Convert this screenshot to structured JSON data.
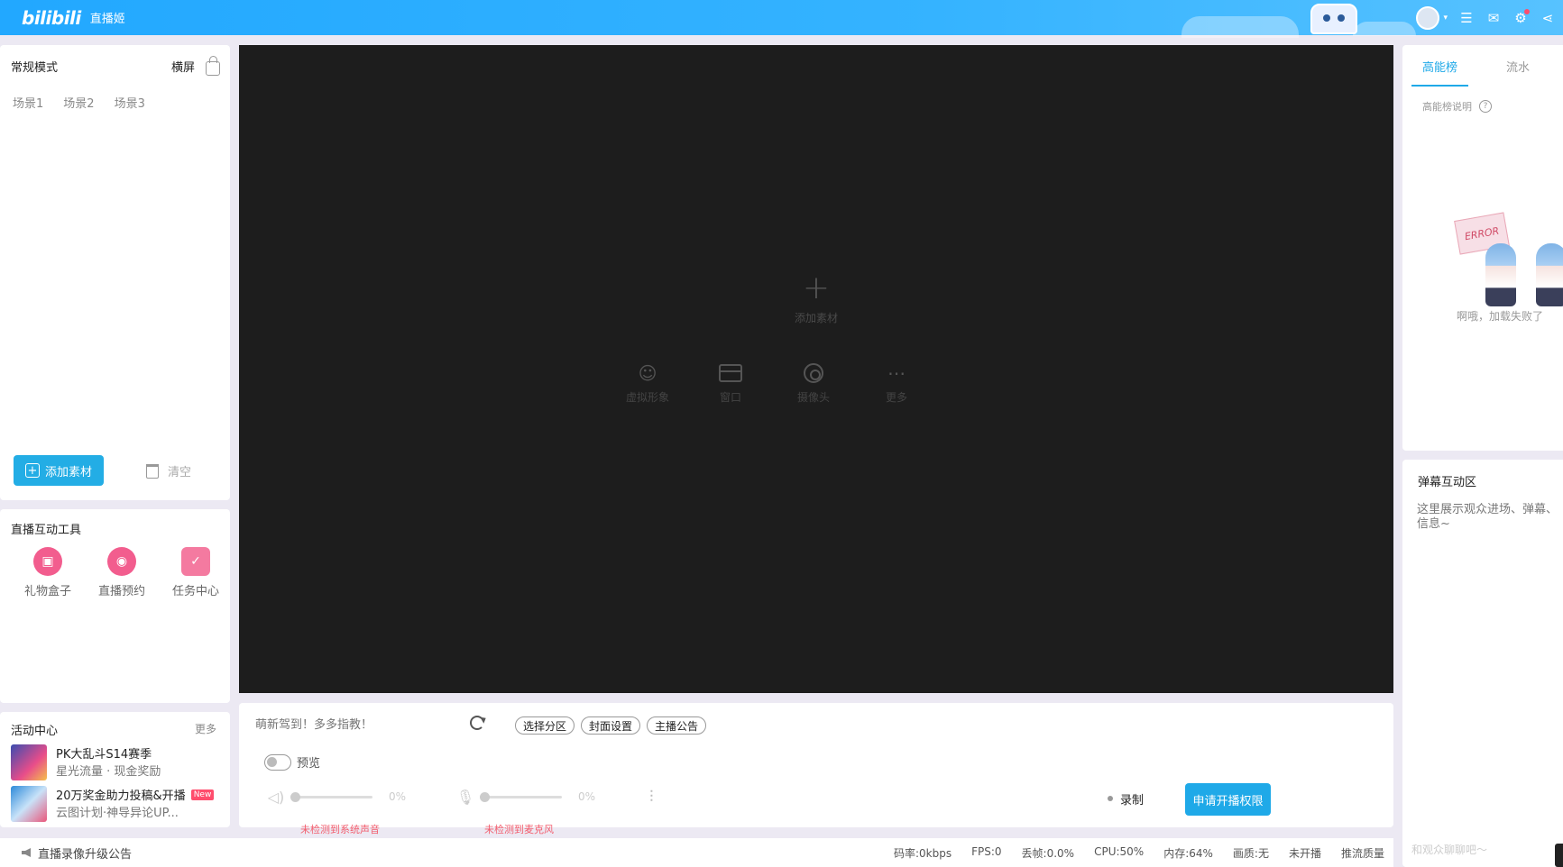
{
  "topbar": {
    "logo": "bilibili",
    "app_name": "直播姬",
    "icons": [
      "avatar",
      "menu-icon",
      "mail-icon",
      "settings-icon",
      "share-icon"
    ]
  },
  "scene_panel": {
    "mode": "常规模式",
    "orientation": "横屏",
    "scenes": [
      "场景1",
      "场景2",
      "场景3"
    ],
    "add_button": "添加素材",
    "clear_button": "清空"
  },
  "tools_panel": {
    "title": "直播互动工具",
    "tools": [
      {
        "label": "礼物盒子",
        "icon": "gift-box-icon"
      },
      {
        "label": "直播预约",
        "icon": "live-reservation-icon"
      },
      {
        "label": "任务中心",
        "icon": "task-center-icon"
      }
    ]
  },
  "activity_panel": {
    "title": "活动中心",
    "more": "更多",
    "items": [
      {
        "name": "PK大乱斗S14赛季",
        "sub": "星光流量 · 现金奖励",
        "badge": ""
      },
      {
        "name": "20万奖金助力投稿&开播",
        "sub": "云图计划·神导异论UP...",
        "badge": "New"
      }
    ]
  },
  "preview": {
    "add_source_label": "添加素材",
    "sources": [
      {
        "label": "虚拟形象",
        "icon": "avatar-figure-icon"
      },
      {
        "label": "窗口",
        "icon": "window-icon"
      },
      {
        "label": "摄像头",
        "icon": "camera-icon"
      },
      {
        "label": "更多",
        "icon": "more-icon"
      }
    ]
  },
  "control_panel": {
    "title_placeholder": "萌新驾到！多多指教！",
    "pills": [
      "选择分区",
      "封面设置",
      "主播公告"
    ],
    "preview_toggle": "预览",
    "system_audio": {
      "percent": "0%",
      "warning": "未检测到系统声音",
      "level": 0
    },
    "mic_audio": {
      "percent": "0%",
      "warning": "未检测到麦克风",
      "level": 0
    },
    "record_button": "录制",
    "live_button": "申请开播权限"
  },
  "statusbar": {
    "notice": "直播录像升级公告",
    "stats": [
      "码率:0kbps",
      "FPS:0",
      "丢帧:0.0%",
      "CPU:50%",
      "内存:64%",
      "画质:无",
      "未开播",
      "推流质量"
    ]
  },
  "rank_panel": {
    "tabs": [
      "高能榜",
      "流水"
    ],
    "help": "高能榜说明",
    "error_sign": "ERROR",
    "fail_text": "啊哦，加载失败了"
  },
  "danmaku_panel": {
    "title": "弹幕互动区",
    "description": "这里展示观众进场、弹幕、信息~",
    "input_placeholder": "和观众聊聊吧～"
  },
  "colors": {
    "brand_blue": "#23ade5",
    "topbar": "#22a8ff",
    "warning": "#f25d6d",
    "pink": "#f25d8e"
  }
}
